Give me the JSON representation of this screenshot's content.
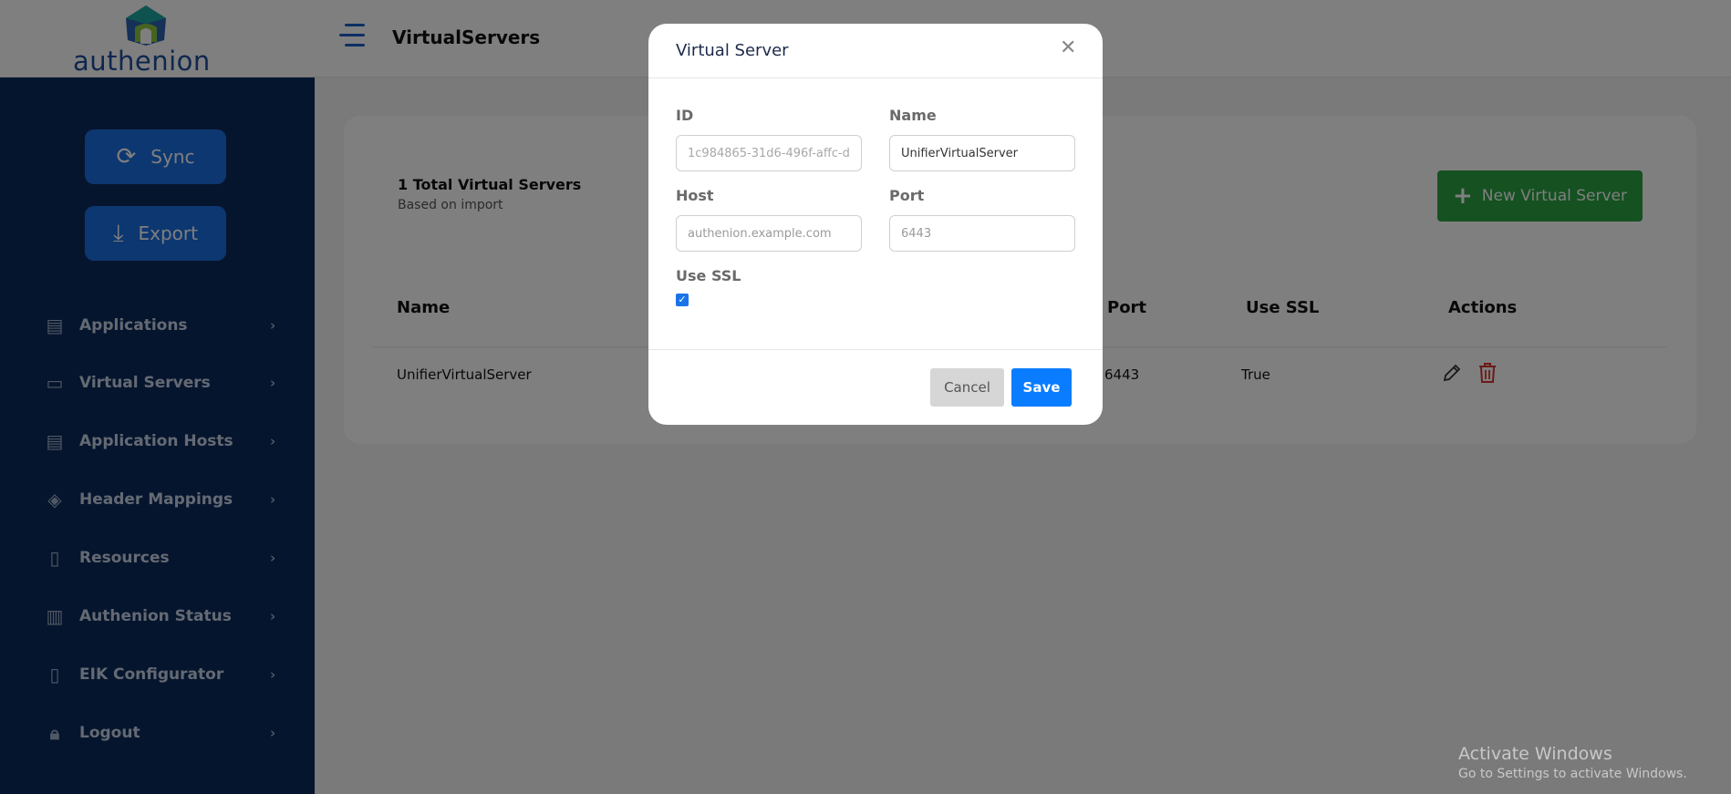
{
  "app": {
    "logo_text": "authenion",
    "page_title": "VirtualServers"
  },
  "sidebar": {
    "sync_label": "Sync",
    "export_label": "Export",
    "items": [
      {
        "label": "Applications",
        "icon": "applications-icon"
      },
      {
        "label": "Virtual Servers",
        "icon": "monitor-icon"
      },
      {
        "label": "Application Hosts",
        "icon": "hosts-icon"
      },
      {
        "label": "Header Mappings",
        "icon": "layers-icon"
      },
      {
        "label": "Resources",
        "icon": "book-icon"
      },
      {
        "label": "Authenion Status",
        "icon": "clipboard-icon"
      },
      {
        "label": "EIK Configurator",
        "icon": "book-icon"
      },
      {
        "label": "Logout",
        "icon": "lock-icon"
      }
    ]
  },
  "main": {
    "total_title": "1 Total Virtual Servers",
    "subtitle": "Based on import",
    "new_button": "New Virtual Server",
    "table": {
      "headers": [
        "Name",
        "Port",
        "Use SSL",
        "Actions"
      ],
      "rows": [
        {
          "name": "UnifierVirtualServer",
          "port": "6443",
          "use_ssl": "True"
        }
      ]
    }
  },
  "modal": {
    "title": "Virtual Server",
    "id_label": "ID",
    "id_value": "1c984865-31d6-496f-affc-d",
    "name_label": "Name",
    "name_value": "UnifierVirtualServer",
    "host_label": "Host",
    "host_placeholder": "authenion.example.com",
    "port_label": "Port",
    "port_value": "6443",
    "use_ssl_label": "Use SSL",
    "use_ssl_checked": true,
    "cancel_label": "Cancel",
    "save_label": "Save"
  },
  "watermark": {
    "line1": "Activate Windows",
    "line2": "Go to Settings to activate Windows."
  },
  "colors": {
    "sidebar_bg": "#0c2a5c",
    "primary": "#1a6fe0",
    "success": "#2aa243",
    "danger": "#d9342b"
  }
}
